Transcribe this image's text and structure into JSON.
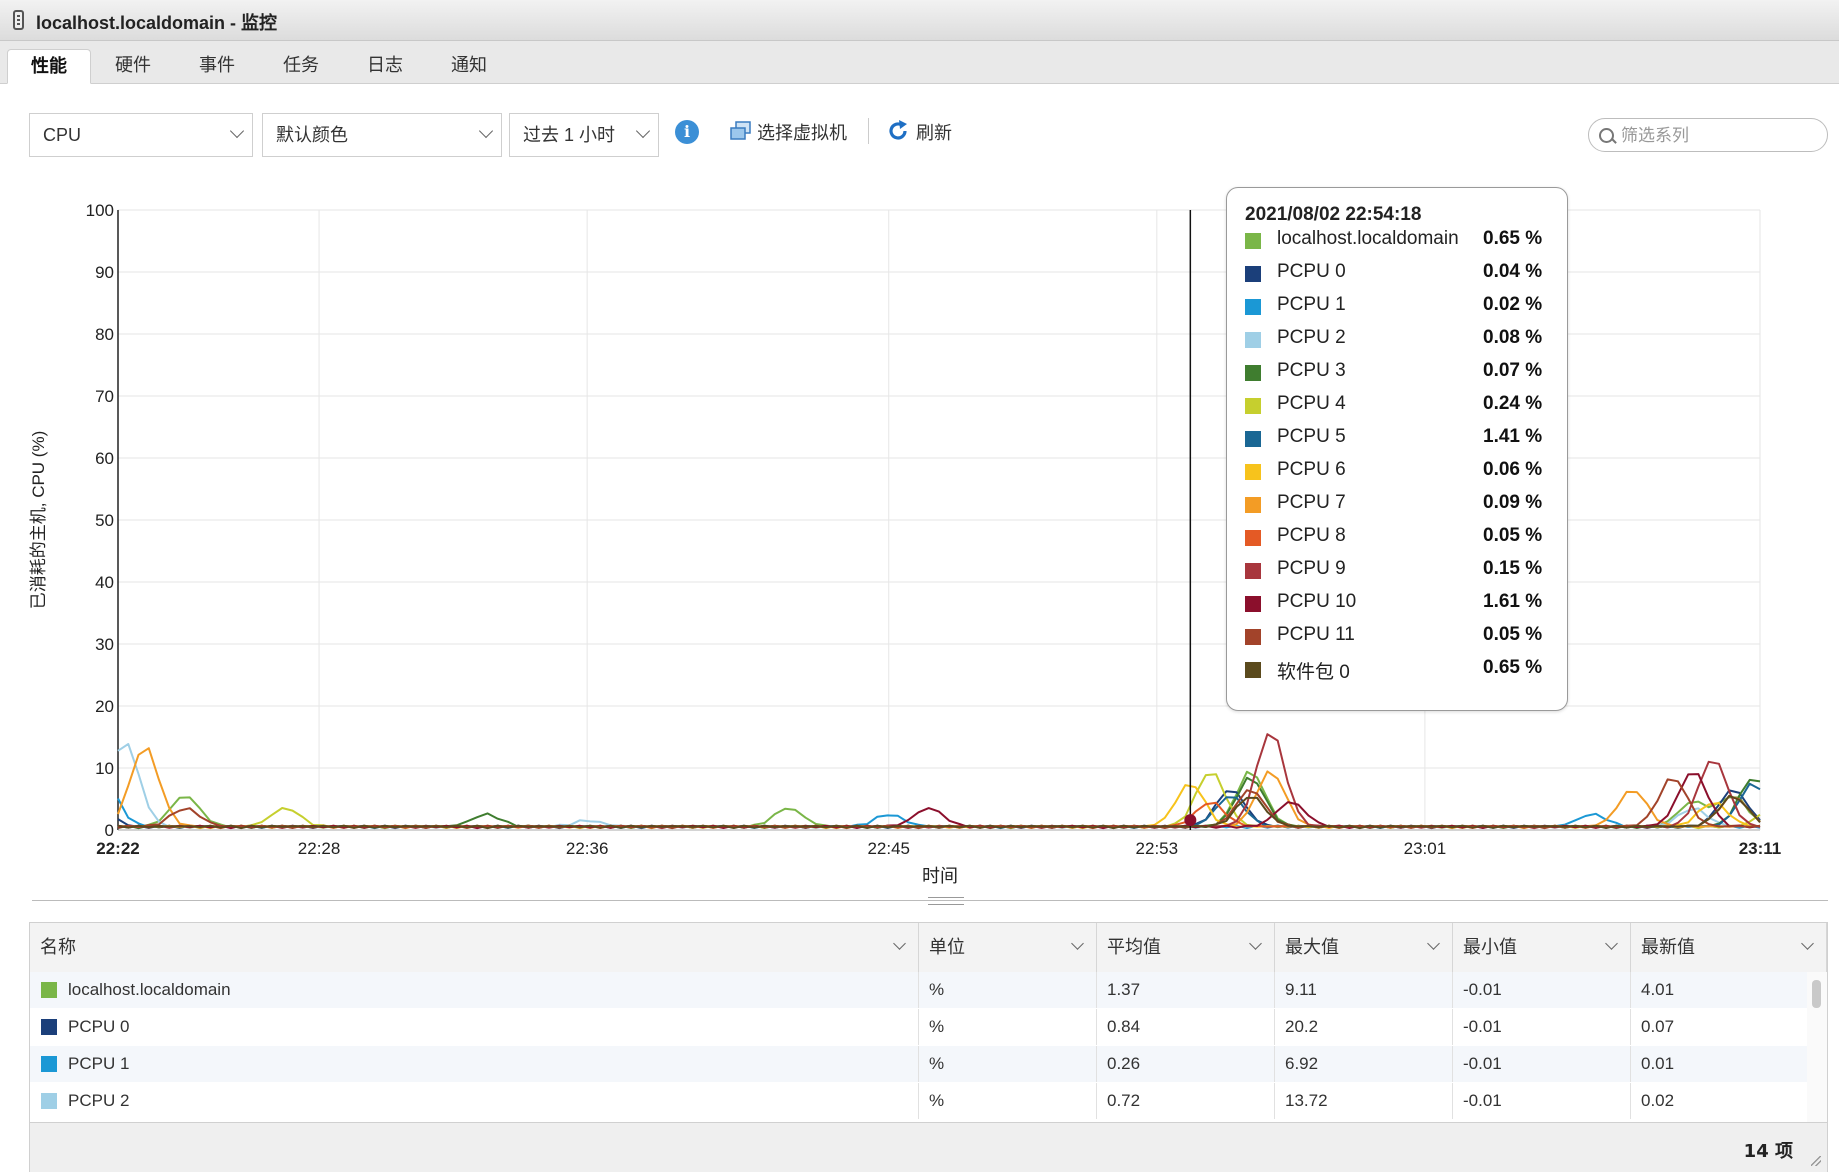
{
  "window": {
    "title": "localhost.localdomain - 监控"
  },
  "tabs": [
    {
      "label": "性能",
      "active": true
    },
    {
      "label": "硬件"
    },
    {
      "label": "事件"
    },
    {
      "label": "任务"
    },
    {
      "label": "日志"
    },
    {
      "label": "通知"
    }
  ],
  "toolbar": {
    "metric": "CPU",
    "color_scheme": "默认颜色",
    "time_range": "过去 1 小时",
    "select_vm_label": "选择虚拟机",
    "refresh_label": "刷新",
    "filter_placeholder": "筛选系列"
  },
  "chart_data": {
    "type": "line",
    "ylabel": "已消耗的主机, CPU (%)",
    "xlabel": "时间",
    "ylim": [
      0,
      100
    ],
    "y_ticks": [
      "0",
      "10",
      "20",
      "30",
      "40",
      "50",
      "60",
      "70",
      "80",
      "90",
      "100"
    ],
    "x_ticks": [
      "22:22",
      "22:28",
      "22:36",
      "22:45",
      "22:53",
      "23:01",
      "23:11"
    ],
    "x_ticks_bold": [
      "22:22",
      "23:11"
    ],
    "cursor_time": "22:54",
    "grid": true,
    "series": [
      {
        "name": "localhost.localdomain",
        "color": "#7ab648",
        "peaks": [
          [
            22.4,
            5
          ],
          [
            22.7,
            3
          ],
          [
            22.93,
            9
          ],
          [
            23.15,
            4
          ],
          [
            23.17,
            5
          ]
        ]
      },
      {
        "name": "PCPU 0",
        "color": "#1b3f7a",
        "peaks": [
          [
            22.23,
            13
          ],
          [
            22.35,
            20.2
          ],
          [
            22.92,
            6
          ],
          [
            23.17,
            6
          ]
        ]
      },
      {
        "name": "PCPU 1",
        "color": "#1b98d5",
        "peaks": [
          [
            22.36,
            6.92
          ],
          [
            22.75,
            2
          ],
          [
            23.1,
            2
          ]
        ]
      },
      {
        "name": "PCPU 2",
        "color": "#9fcfe6",
        "peaks": [
          [
            22.37,
            13.72
          ],
          [
            22.6,
            1
          ],
          [
            23.15,
            3
          ]
        ]
      },
      {
        "name": "PCPU 3",
        "color": "#3f7d2f",
        "peaks": [
          [
            22.27,
            4
          ],
          [
            22.55,
            2
          ],
          [
            22.93,
            8
          ],
          [
            23.18,
            8
          ]
        ]
      },
      {
        "name": "PCPU 4",
        "color": "#c6cf2e",
        "peaks": [
          [
            22.23,
            7
          ],
          [
            22.45,
            3
          ],
          [
            22.91,
            9
          ],
          [
            23.19,
            3
          ]
        ]
      },
      {
        "name": "PCPU 5",
        "color": "#1a6794",
        "peaks": [
          [
            22.26,
            8
          ],
          [
            22.92,
            5
          ],
          [
            23.18,
            7
          ]
        ]
      },
      {
        "name": "PCPU 6",
        "color": "#f7c31c",
        "peaks": [
          [
            22.24,
            6
          ],
          [
            22.9,
            7
          ],
          [
            23.16,
            4
          ]
        ]
      },
      {
        "name": "PCPU 7",
        "color": "#f39c25",
        "peaks": [
          [
            22.38,
            13
          ],
          [
            22.94,
            9
          ],
          [
            23.12,
            6
          ]
        ]
      },
      {
        "name": "PCPU 8",
        "color": "#e45a25",
        "peaks": [
          [
            22.27,
            5
          ],
          [
            22.91,
            4
          ],
          [
            23.17,
            5
          ]
        ]
      },
      {
        "name": "PCPU 9",
        "color": "#a8363d",
        "peaks": [
          [
            22.27,
            14.5
          ],
          [
            22.94,
            15.5
          ],
          [
            23.16,
            11
          ]
        ]
      },
      {
        "name": "PCPU 10",
        "color": "#8b0f2c",
        "peaks": [
          [
            22.28,
            3
          ],
          [
            22.77,
            3
          ],
          [
            22.95,
            4
          ],
          [
            23.15,
            9
          ]
        ]
      },
      {
        "name": "PCPU 11",
        "color": "#a2432a",
        "peaks": [
          [
            22.4,
            3
          ],
          [
            22.93,
            6
          ],
          [
            23.14,
            8
          ]
        ]
      },
      {
        "name": "软件包 0",
        "color": "#5b4a1d",
        "peaks": [
          [
            22.3,
            3
          ],
          [
            22.93,
            5
          ],
          [
            23.17,
            5
          ]
        ]
      }
    ]
  },
  "tooltip": {
    "time": "2021/08/02 22:54:18",
    "rows": [
      {
        "name": "localhost.localdomain",
        "value": "0.65 %",
        "color": "#7ab648"
      },
      {
        "name": "PCPU 0",
        "value": "0.04 %",
        "color": "#1b3f7a"
      },
      {
        "name": "PCPU 1",
        "value": "0.02 %",
        "color": "#1b98d5"
      },
      {
        "name": "PCPU 2",
        "value": "0.08 %",
        "color": "#9fcfe6"
      },
      {
        "name": "PCPU 3",
        "value": "0.07 %",
        "color": "#3f7d2f"
      },
      {
        "name": "PCPU 4",
        "value": "0.24 %",
        "color": "#c6cf2e"
      },
      {
        "name": "PCPU 5",
        "value": "1.41 %",
        "color": "#1a6794"
      },
      {
        "name": "PCPU 6",
        "value": "0.06 %",
        "color": "#f7c31c"
      },
      {
        "name": "PCPU 7",
        "value": "0.09 %",
        "color": "#f39c25"
      },
      {
        "name": "PCPU 8",
        "value": "0.05 %",
        "color": "#e45a25"
      },
      {
        "name": "PCPU 9",
        "value": "0.15 %",
        "color": "#a8363d"
      },
      {
        "name": "PCPU 10",
        "value": "1.61 %",
        "color": "#8b0f2c"
      },
      {
        "name": "PCPU 11",
        "value": "0.05 %",
        "color": "#a2432a"
      },
      {
        "name": "软件包 0",
        "value": "0.65 %",
        "color": "#5b4a1d"
      }
    ]
  },
  "table": {
    "columns": [
      "名称",
      "单位",
      "平均值",
      "最大值",
      "最小值",
      "最新值"
    ],
    "rows": [
      {
        "name": "localhost.localdomain",
        "color": "#7ab648",
        "unit": "%",
        "avg": "1.37",
        "max": "9.11",
        "min": "-0.01",
        "latest": "4.01"
      },
      {
        "name": "PCPU 0",
        "color": "#1b3f7a",
        "unit": "%",
        "avg": "0.84",
        "max": "20.2",
        "min": "-0.01",
        "latest": "0.07"
      },
      {
        "name": "PCPU 1",
        "color": "#1b98d5",
        "unit": "%",
        "avg": "0.26",
        "max": "6.92",
        "min": "-0.01",
        "latest": "0.01"
      },
      {
        "name": "PCPU 2",
        "color": "#9fcfe6",
        "unit": "%",
        "avg": "0.72",
        "max": "13.72",
        "min": "-0.01",
        "latest": "0.02"
      }
    ],
    "footer_count": "14 项"
  }
}
